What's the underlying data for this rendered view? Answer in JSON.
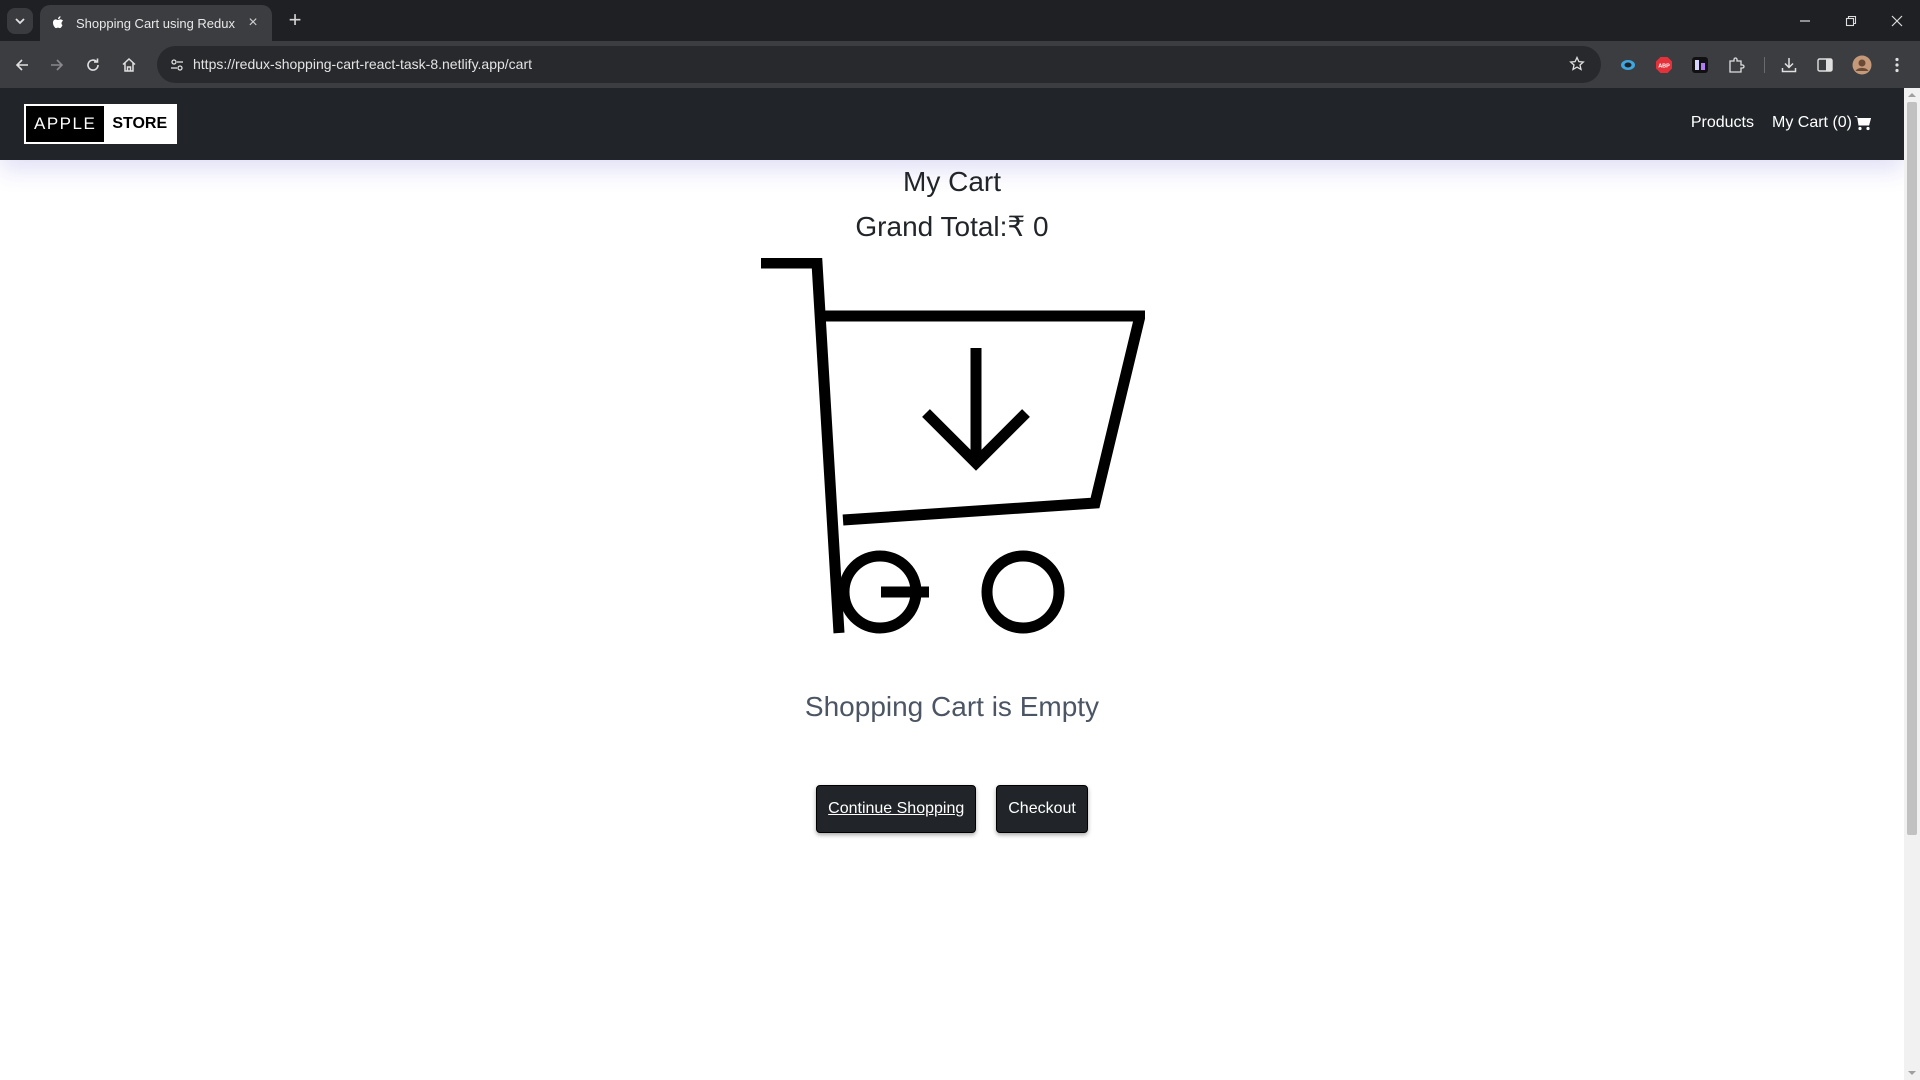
{
  "browser": {
    "tab_title": "Shopping Cart using Redux",
    "new_tab": "+",
    "tab_close": "×",
    "url": "https://redux-shopping-cart-react-task-8.netlify.app/cart",
    "colors": {
      "chrome_dark": "#1f2023",
      "chrome_mid": "#3c3d41",
      "omnibox": "#28292c"
    }
  },
  "navbar": {
    "brand_left": "APPLE",
    "brand_right": "STORE",
    "products_label": "Products",
    "cart_label": "My Cart (0)",
    "bg_color": "#212529"
  },
  "cart": {
    "heading": "My Cart",
    "grand_total": "Grand Total:₹ 0",
    "empty_message": "Shopping Cart is Empty",
    "continue_label": "Continue Shopping",
    "checkout_label": "Checkout",
    "illustration": "cart-download-icon"
  }
}
